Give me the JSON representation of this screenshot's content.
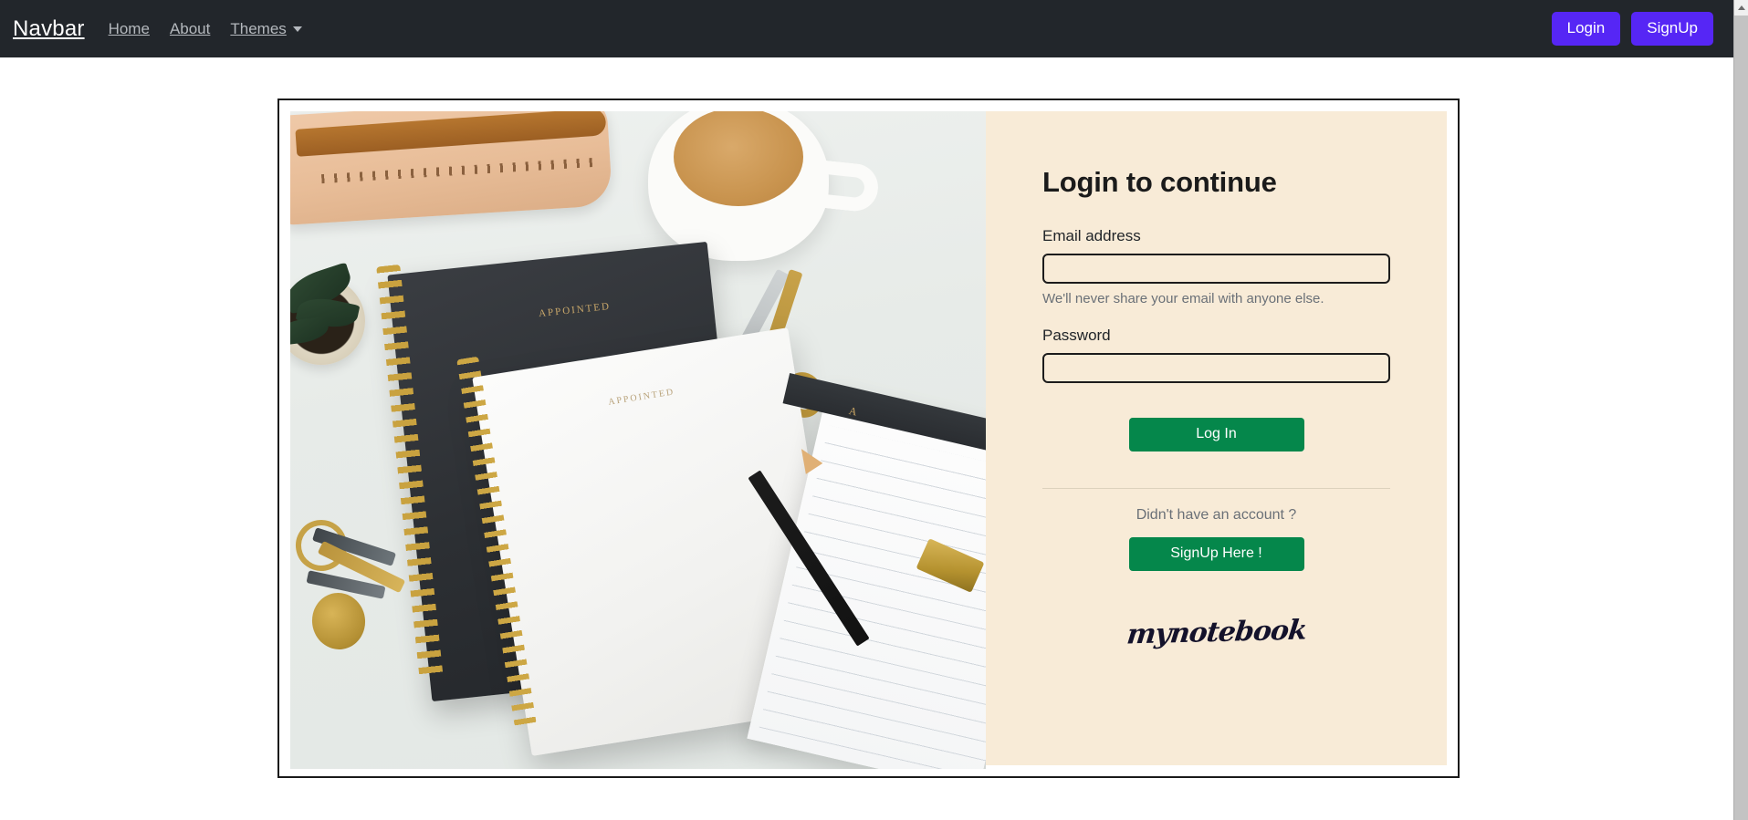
{
  "navbar": {
    "brand": "Navbar",
    "links": [
      {
        "label": "Home",
        "icon": ""
      },
      {
        "label": "About",
        "icon": ""
      },
      {
        "label": "Themes",
        "icon": "chevron-down-icon"
      }
    ],
    "login_label": "Login",
    "signup_label": "SignUp",
    "background_color": "#22262b",
    "button_color": "#5626f5"
  },
  "card": {
    "panel_background_color": "#f8ebd7",
    "border_color": "#1a1a1a"
  },
  "photo": {
    "alt": "flat-lay of notebooks, coffee mug, scissors, keys, plant and notepad",
    "notebook_dark_logo": "APPOINTED",
    "notebook_white_logo": "APPOINTED",
    "notepad_logo": "A"
  },
  "form": {
    "title": "Login to continue",
    "email": {
      "label": "Email address",
      "value": "",
      "placeholder": "",
      "help": "We'll never share your email with anyone else."
    },
    "password": {
      "label": "Password",
      "value": "",
      "placeholder": ""
    },
    "login_button": "Log In",
    "signup_prompt": "Didn't have an account ?",
    "signup_button": "SignUp Here !",
    "button_color": "#05874b"
  },
  "branding": {
    "logo_text": "mynotebook"
  },
  "scrollbar": {
    "up_arrow": "scroll-up-arrow"
  }
}
